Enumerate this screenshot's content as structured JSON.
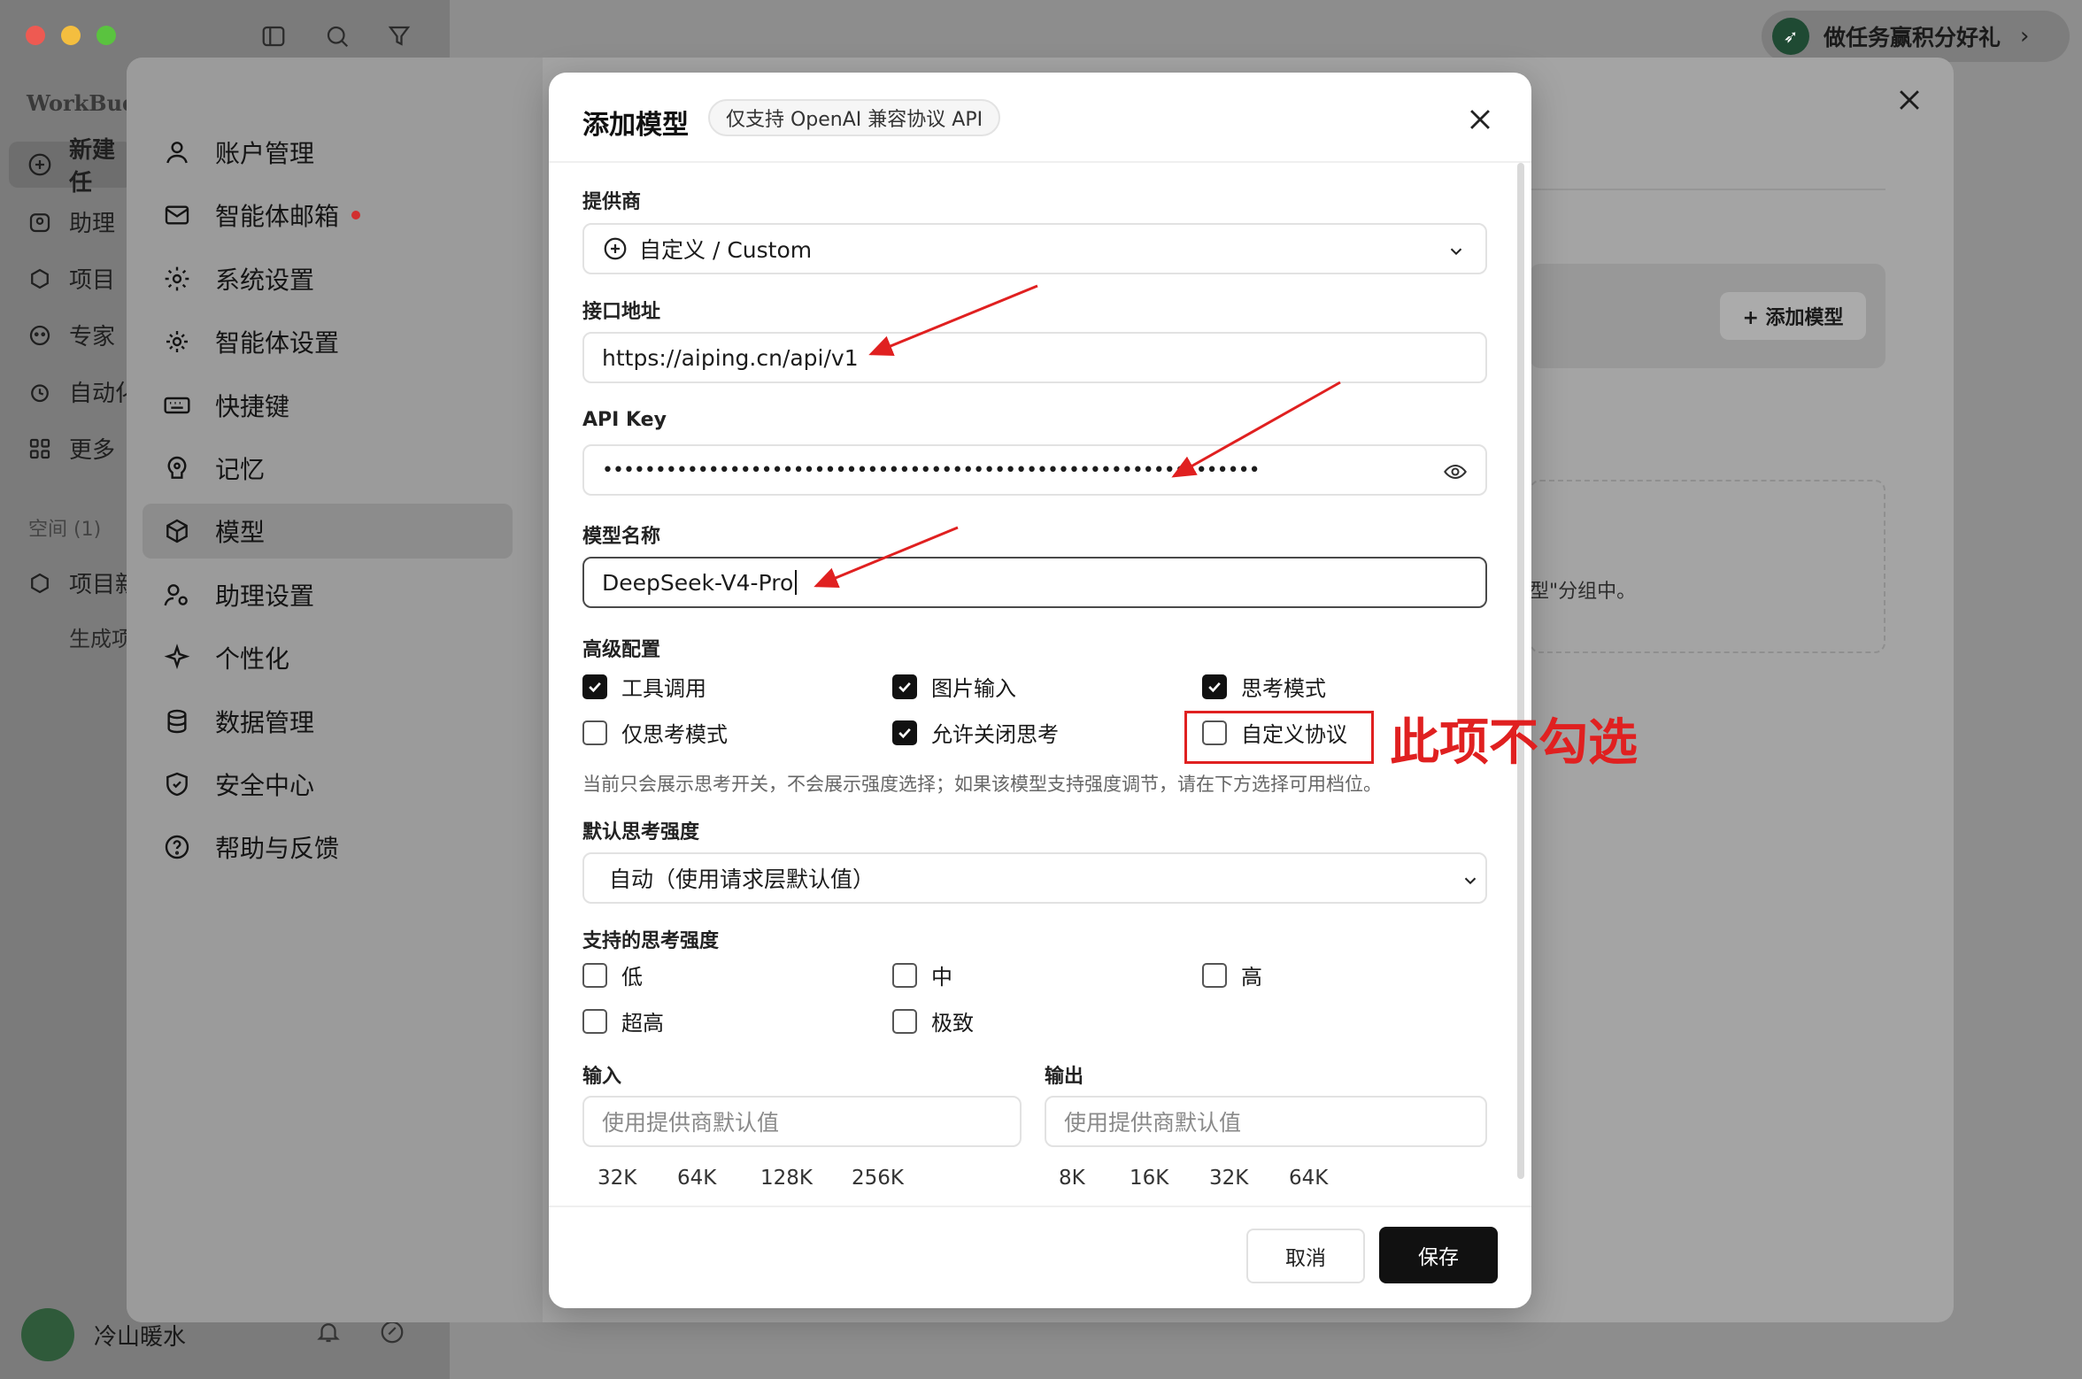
{
  "app": {
    "brand": "WorkBudd",
    "promo_text": "做任务赢积分好礼",
    "new_label": "新建任",
    "nav": [
      "助理",
      "项目",
      "专家",
      "自动化",
      "更多"
    ],
    "space_label": "空间 (1)",
    "space_item": "项目新",
    "space_sub": "生成项",
    "user_name": "冷山暖水"
  },
  "settings": {
    "nav": [
      {
        "label": "账户管理",
        "icon": "user-icon"
      },
      {
        "label": "智能体邮箱",
        "icon": "mail-icon",
        "dot": true
      },
      {
        "label": "系统设置",
        "icon": "gear-icon"
      },
      {
        "label": "智能体设置",
        "icon": "agent-gear-icon"
      },
      {
        "label": "快捷键",
        "icon": "keyboard-icon"
      },
      {
        "label": "记忆",
        "icon": "memory-icon"
      },
      {
        "label": "模型",
        "icon": "cube-icon",
        "active": true
      },
      {
        "label": "助理设置",
        "icon": "assistant-settings-icon"
      },
      {
        "label": "个性化",
        "icon": "sparkle-icon"
      },
      {
        "label": "数据管理",
        "icon": "database-icon"
      },
      {
        "label": "安全中心",
        "icon": "shield-icon"
      },
      {
        "label": "帮助与反馈",
        "icon": "help-icon"
      }
    ],
    "add_model_button": "+ 添加模型",
    "group_hint": "型\"分组中。"
  },
  "modal": {
    "title": "添加模型",
    "tag": "仅支持 OpenAI 兼容协议 API",
    "provider_label": "提供商",
    "provider_value": "自定义 / Custom",
    "endpoint_label": "接口地址",
    "endpoint_value": "https://aiping.cn/api/v1",
    "api_key_label": "API Key",
    "api_key_value": "••••••••••••••••••••••••••••••••••••••••••••••••••••••••••••••",
    "model_name_label": "模型名称",
    "model_name_value": "DeepSeek-V4-Pro",
    "advanced_label": "高级配置",
    "advanced_options": [
      {
        "label": "工具调用",
        "checked": true
      },
      {
        "label": "图片输入",
        "checked": true
      },
      {
        "label": "思考模式",
        "checked": true
      },
      {
        "label": "仅思考模式",
        "checked": false
      },
      {
        "label": "允许关闭思考",
        "checked": true
      },
      {
        "label": "自定义协议",
        "checked": false
      }
    ],
    "hint": "当前只会展示思考开关，不会展示强度选择；如果该模型支持强度调节，请在下方选择可用档位。",
    "default_effort_label": "默认思考强度",
    "default_effort_value": "自动（使用请求层默认值）",
    "supported_effort_label": "支持的思考强度",
    "supported_efforts": [
      {
        "label": "低",
        "checked": false
      },
      {
        "label": "中",
        "checked": false
      },
      {
        "label": "高",
        "checked": false
      },
      {
        "label": "超高",
        "checked": false
      },
      {
        "label": "极致",
        "checked": false
      }
    ],
    "input_label": "输入",
    "input_placeholder": "使用提供商默认值",
    "input_presets": [
      "32K",
      "64K",
      "128K",
      "256K"
    ],
    "output_label": "输出",
    "output_placeholder": "使用提供商默认值",
    "output_presets": [
      "8K",
      "16K",
      "32K",
      "64K"
    ],
    "cancel": "取消",
    "save": "保存"
  },
  "annotation": {
    "text": "此项不勾选",
    "color": "#e02020"
  }
}
